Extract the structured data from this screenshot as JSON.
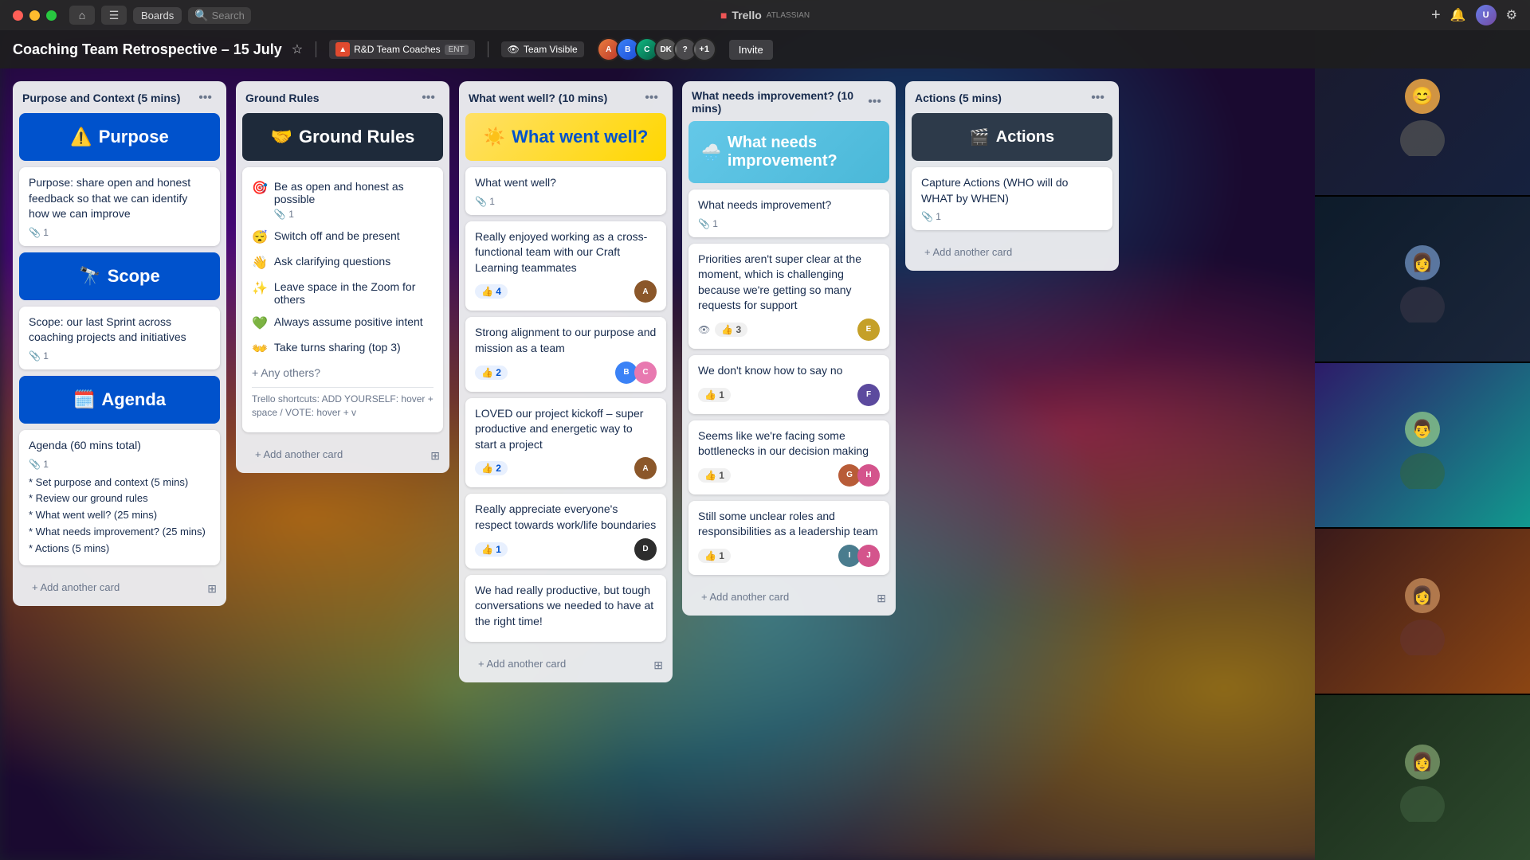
{
  "titlebar": {
    "home_icon": "⌂",
    "boards_label": "Boards",
    "search_placeholder": "Search",
    "trello_logo": "Trello",
    "atlassian_label": "ATLASSIAN",
    "add_icon": "+",
    "notifications_icon": "🔔",
    "settings_icon": "⚙"
  },
  "header": {
    "board_title": "Coaching Team Retrospective – 15 July",
    "workspace_name": "R&D Team Coaches",
    "workspace_badge": "ENT",
    "visibility": "Team Visible",
    "invite_label": "Invite",
    "more_members": "+1"
  },
  "columns": [
    {
      "id": "purpose",
      "title": "Purpose and Context (5 mins)",
      "cards": [
        {
          "type": "hero-blue",
          "emoji": "⚠️",
          "text": "Purpose",
          "attachment": "1"
        },
        {
          "type": "normal",
          "text": "Purpose: share open and honest feedback so that we can identify how we can improve",
          "attachment": "1"
        },
        {
          "type": "hero-blue",
          "emoji": "🔭",
          "text": "Scope",
          "attachment": "1"
        },
        {
          "type": "normal",
          "text": "Scope: our last Sprint across coaching projects and initiatives",
          "attachment": "1"
        },
        {
          "type": "hero-blue",
          "emoji": "🗓️",
          "text": "Agenda",
          "attachment": "1"
        },
        {
          "type": "normal",
          "text": "Agenda (60 mins total)",
          "attachment": "1",
          "items": [
            "* Set purpose and context (5 mins)",
            "* Review our ground rules",
            "* What went well? (25 mins)",
            "* What needs improvement? (25 mins)",
            "* Actions (5 mins)"
          ]
        }
      ],
      "add_label": "+ Add another card"
    },
    {
      "id": "ground-rules",
      "title": "Ground Rules",
      "cards": [
        {
          "type": "hero-dark",
          "emoji": "🤝",
          "text": "Ground Rules"
        },
        {
          "type": "list-item",
          "emoji": "🎯",
          "text": "Be as open and honest as possible",
          "attachment": "1"
        },
        {
          "type": "list-item",
          "emoji": "😴",
          "text": "Switch off and be present"
        },
        {
          "type": "list-item",
          "emoji": "👋",
          "text": "Ask clarifying questions"
        },
        {
          "type": "list-item",
          "emoji": "✨",
          "text": "Leave space in the Zoom for others"
        },
        {
          "type": "list-item",
          "emoji": "💚",
          "text": "Always assume positive intent"
        },
        {
          "type": "list-item",
          "emoji": "👐",
          "text": "Take turns sharing (top 3)"
        },
        {
          "type": "any-others",
          "text": "+ Any others?"
        },
        {
          "type": "shortcut",
          "text": "Trello shortcuts: ADD YOURSELF: hover + space / VOTE: hover + v"
        }
      ],
      "add_label": "+ Add another card"
    },
    {
      "id": "went-well",
      "title": "What went well? (10 mins)",
      "cards": [
        {
          "type": "hero-yellow",
          "emoji": "☀️",
          "text": "What went well?"
        },
        {
          "type": "normal",
          "text": "What went well?",
          "attachment": "1"
        },
        {
          "type": "normal",
          "text": "Really enjoyed working as a cross-functional team with our Craft Learning teammates",
          "votes": 4,
          "votes_type": "blue",
          "avatar_colors": [
            "#8b572a"
          ]
        },
        {
          "type": "normal",
          "text": "Strong alignment to our purpose and mission as a team",
          "votes": 2,
          "votes_type": "blue",
          "avatar_colors": [
            "#3b82f6",
            "#e879b0"
          ]
        },
        {
          "type": "normal",
          "text": "LOVED our project kickoff – super productive and energetic way to start a project",
          "votes": 2,
          "votes_type": "blue",
          "avatar_colors": [
            "#8b572a"
          ]
        },
        {
          "type": "normal",
          "text": "Really appreciate everyone's respect towards work/life boundaries",
          "votes": 1,
          "votes_type": "blue",
          "avatar_colors": [
            "#2d2d2d"
          ]
        },
        {
          "type": "normal",
          "text": "We had really productive, but tough conversations we needed to have at the right time!"
        }
      ],
      "add_label": "+ Add another card"
    },
    {
      "id": "improvement",
      "title": "What needs improvement? (10 mins)",
      "cards": [
        {
          "type": "hero-lightblue",
          "emoji": "🌧️",
          "text": "What needs improvement?"
        },
        {
          "type": "normal",
          "text": "What needs improvement?",
          "attachment": "1"
        },
        {
          "type": "normal",
          "text": "Priorities aren't super clear at the moment, which is challenging because we're getting so many requests for support",
          "watch": true,
          "votes": 3,
          "votes_type": "gray",
          "avatar_colors": [
            "#c5a028"
          ]
        },
        {
          "type": "normal",
          "text": "We don't know how to say no",
          "votes": 1,
          "votes_type": "gray",
          "avatar_colors": [
            "#5c4a9e"
          ]
        },
        {
          "type": "normal",
          "text": "Seems like we're facing some bottlenecks in our decision making",
          "votes": 1,
          "votes_type": "gray",
          "avatar_colors": [
            "#b85c38",
            "#d4548c"
          ]
        },
        {
          "type": "normal",
          "text": "Still some unclear roles and responsibilities as a leadership team",
          "votes": 1,
          "votes_type": "gray",
          "avatar_colors": [
            "#4a7c8e",
            "#d4548c"
          ]
        }
      ],
      "add_label": "+ Add another card"
    },
    {
      "id": "actions",
      "title": "Actions (5 mins)",
      "cards": [
        {
          "type": "hero-darkgray",
          "emoji": "🎬",
          "text": "Actions"
        },
        {
          "type": "normal",
          "text": "Capture Actions (WHO will do WHAT by WHEN)",
          "attachment": "1"
        }
      ],
      "add_label": "+ Add another card"
    }
  ],
  "video_panel": {
    "cells": [
      {
        "emoji": "😊",
        "bg": "video-bg-1"
      },
      {
        "emoji": "👩‍💼",
        "bg": "video-bg-2"
      },
      {
        "emoji": "👨",
        "bg": "video-bg-3"
      },
      {
        "emoji": "👩",
        "bg": "video-bg-4"
      },
      {
        "emoji": "👩‍🦓",
        "bg": "video-bg-5"
      }
    ]
  }
}
